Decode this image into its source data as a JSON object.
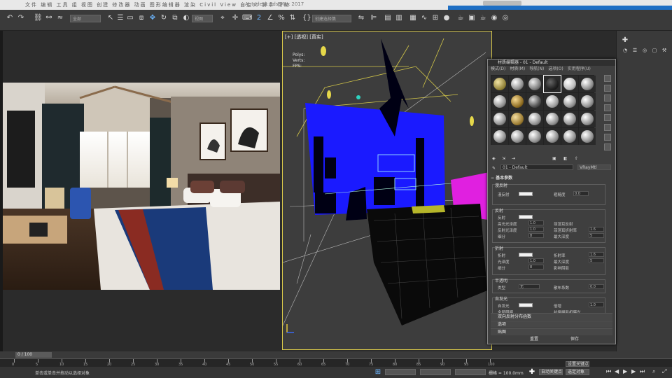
{
  "window": {
    "title": "Autodesk 3ds Max 2017",
    "menu_glyphs": "文件 编辑 工具 组 视图 创建 修改器 动画 图形编辑器 渲染 Civil View 自定义 脚本 帮助"
  },
  "toolbar": {
    "selection_filter": "全部",
    "named_selection": "创建选择集"
  },
  "viewport": {
    "label": "[+] [透视] [真实]",
    "overlay_text": [
      "Polys:",
      "Verts:",
      "FPS:"
    ]
  },
  "material_editor": {
    "title": "材质编辑器 - 01 - Default",
    "menu": [
      "模式(D)",
      "材质(M)",
      "导航(N)",
      "选项(O)",
      "实用程序(U)"
    ],
    "material_name": "01 - Default",
    "material_type": "VRayMtl",
    "basic_params_title": "基本参数",
    "groups": [
      {
        "name": "漫反射",
        "rows": [
          {
            "label": "漫反射",
            "value": "",
            "right_label": "粗糙度",
            "right_value": "0.0"
          }
        ]
      },
      {
        "name": "反射",
        "rows": [
          {
            "label": "反射",
            "value": "",
            "right_label": "",
            "right_value": ""
          },
          {
            "label": "高光光泽度",
            "value": "1.0",
            "right_label": "菲涅耳反射",
            "right_value": ""
          },
          {
            "label": "反射光泽度",
            "value": "1.0",
            "right_label": "菲涅耳折射率",
            "right_value": "1.6"
          },
          {
            "label": "细分",
            "value": "8",
            "right_label": "最大深度",
            "right_value": "5"
          }
        ]
      },
      {
        "name": "折射",
        "rows": [
          {
            "label": "折射",
            "value": "",
            "right_label": "折射率",
            "right_value": "1.6"
          },
          {
            "label": "光泽度",
            "value": "1.0",
            "right_label": "最大深度",
            "right_value": "5"
          },
          {
            "label": "细分",
            "value": "8",
            "right_label": "影响阴影",
            "right_value": ""
          }
        ]
      },
      {
        "name": "半透明",
        "rows": [
          {
            "label": "类型",
            "value": "无",
            "right_label": "散布系数",
            "right_value": "0.0"
          }
        ]
      },
      {
        "name": "自发光",
        "rows": [
          {
            "label": "自发光",
            "value": "",
            "right_label": "倍增",
            "right_value": "1.0"
          },
          {
            "label": "全局照明",
            "value": "",
            "right_label": "补偿摄影机曝光",
            "right_value": ""
          }
        ]
      }
    ],
    "rollouts": [
      "双向反射分布函数",
      "选项",
      "贴图"
    ],
    "footer": [
      "重置",
      "保存"
    ]
  },
  "timeline": {
    "frame": "0 / 100",
    "ticks": [
      "0",
      "5",
      "10",
      "15",
      "20",
      "25",
      "30",
      "35",
      "40",
      "45",
      "50",
      "55",
      "60",
      "65",
      "70",
      "75",
      "80",
      "85",
      "90",
      "95",
      "100"
    ]
  },
  "status": {
    "prompt": "单击或单击并拖动以选择对象",
    "grid": "栅格 = 100.0mm",
    "autokey": "自动关键点",
    "selected": "选定对象",
    "setkey": "设置关键点"
  },
  "colors": {
    "accent_blue": "#1f6fc4",
    "wire_yellow": "#e6d84a",
    "room_blue": "#1a1aff",
    "magenta": "#e020e0"
  }
}
